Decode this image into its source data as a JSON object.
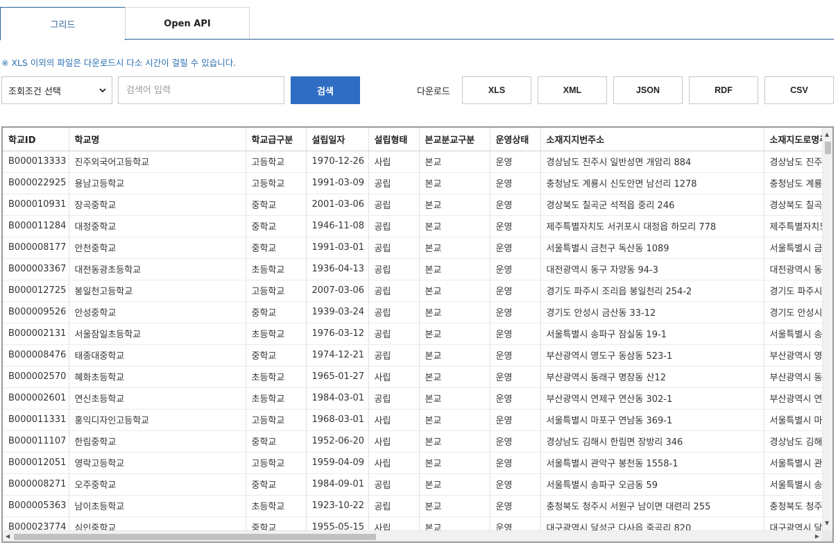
{
  "tabs": [
    {
      "label": "그리드",
      "active": true
    },
    {
      "label": "Open API",
      "active": false
    }
  ],
  "notice": "※ XLS 이외의 파일은 다운로드시 다소 시간이 걸릴 수 있습니다.",
  "search": {
    "condition_selected": "조회조건 선택",
    "placeholder": "검색어 입력",
    "value": "",
    "button_label": "검색"
  },
  "download": {
    "label": "다운로드",
    "buttons": [
      "XLS",
      "XML",
      "JSON",
      "RDF",
      "CSV"
    ]
  },
  "colors": {
    "accent": "#2f6dc3",
    "tab_border": "#2b5f9a",
    "notice_text": "#2a6fb0"
  },
  "grid": {
    "columns": [
      "학교ID",
      "학교명",
      "학교급구분",
      "설립일자",
      "설립형태",
      "본교분교구분",
      "운영상태",
      "소재지지번주소",
      "소재지도로명주소"
    ],
    "rows": [
      [
        "B000013333",
        "진주외국어고등학교",
        "고등학교",
        "1970-12-26",
        "사립",
        "본교",
        "운영",
        "경상남도 진주시 일반성면 개암리 884",
        "경상남도 진주시"
      ],
      [
        "B000022925",
        "용남고등학교",
        "고등학교",
        "1991-03-09",
        "공립",
        "본교",
        "운영",
        "충청남도 계룡시 신도안면 남선리 1278",
        "충청남도 계룡시"
      ],
      [
        "B000010931",
        "장곡중학교",
        "중학교",
        "2001-03-06",
        "공립",
        "본교",
        "운영",
        "경상북도 칠곡군 석적읍 중리 246",
        "경상북도 칠곡군"
      ],
      [
        "B000011284",
        "대정중학교",
        "중학교",
        "1946-11-08",
        "공립",
        "본교",
        "운영",
        "제주특별자치도 서귀포시 대정읍 하모리 778",
        "제주특별자치도"
      ],
      [
        "B000008177",
        "안천중학교",
        "중학교",
        "1991-03-01",
        "공립",
        "본교",
        "운영",
        "서울특별시 금천구 독산동 1089",
        "서울특별시 금천구"
      ],
      [
        "B000003367",
        "대전동광초등학교",
        "초등학교",
        "1936-04-13",
        "공립",
        "본교",
        "운영",
        "대전광역시 동구 자양동 94-3",
        "대전광역시 동구"
      ],
      [
        "B000012725",
        "봉일천고등학교",
        "고등학교",
        "2007-03-06",
        "공립",
        "본교",
        "운영",
        "경기도 파주시 조리읍 봉일천리 254-2",
        "경기도 파주시"
      ],
      [
        "B000009526",
        "안성중학교",
        "중학교",
        "1939-03-24",
        "공립",
        "본교",
        "운영",
        "경기도 안성시 금산동 33-12",
        "경기도 안성시"
      ],
      [
        "B000002131",
        "서울잠일초등학교",
        "초등학교",
        "1976-03-12",
        "공립",
        "본교",
        "운영",
        "서울특별시 송파구 잠실동 19-1",
        "서울특별시 송파구"
      ],
      [
        "B000008476",
        "태종대중학교",
        "중학교",
        "1974-12-21",
        "공립",
        "본교",
        "운영",
        "부산광역시 영도구 동삼동 523-1",
        "부산광역시 영도구"
      ],
      [
        "B000002570",
        "혜화초등학교",
        "초등학교",
        "1965-01-27",
        "사립",
        "본교",
        "운영",
        "부산광역시 동래구 명장동 산12",
        "부산광역시 동래구"
      ],
      [
        "B000002601",
        "연신초등학교",
        "초등학교",
        "1984-03-01",
        "공립",
        "본교",
        "운영",
        "부산광역시 연제구 연산동 302-1",
        "부산광역시 연제구"
      ],
      [
        "B000011331",
        "홍익디자인고등학교",
        "고등학교",
        "1968-03-01",
        "사립",
        "본교",
        "운영",
        "서울특별시 마포구 연남동 369-1",
        "서울특별시 마포구"
      ],
      [
        "B000011107",
        "한림중학교",
        "중학교",
        "1952-06-20",
        "사립",
        "본교",
        "운영",
        "경상남도 김해시 한림면 장방리 346",
        "경상남도 김해시"
      ],
      [
        "B000012051",
        "영락고등학교",
        "고등학교",
        "1959-04-09",
        "사립",
        "본교",
        "운영",
        "서울특별시 관악구 봉천동 1558-1",
        "서울특별시 관악구"
      ],
      [
        "B000008271",
        "오주중학교",
        "중학교",
        "1984-09-01",
        "공립",
        "본교",
        "운영",
        "서울특별시 송파구 오금동 59",
        "서울특별시 송파구"
      ],
      [
        "B000005363",
        "남이초등학교",
        "초등학교",
        "1923-10-22",
        "공립",
        "본교",
        "운영",
        "충청북도 청주시 서원구 남이면 대련리 255",
        "충청북도 청주시"
      ],
      [
        "B000023774",
        "심인중학교",
        "중학교",
        "1955-05-15",
        "사립",
        "본교",
        "운영",
        "대구광역시 달성군 다사읍 죽곡리 820",
        "대구광역시 달성군"
      ]
    ]
  }
}
